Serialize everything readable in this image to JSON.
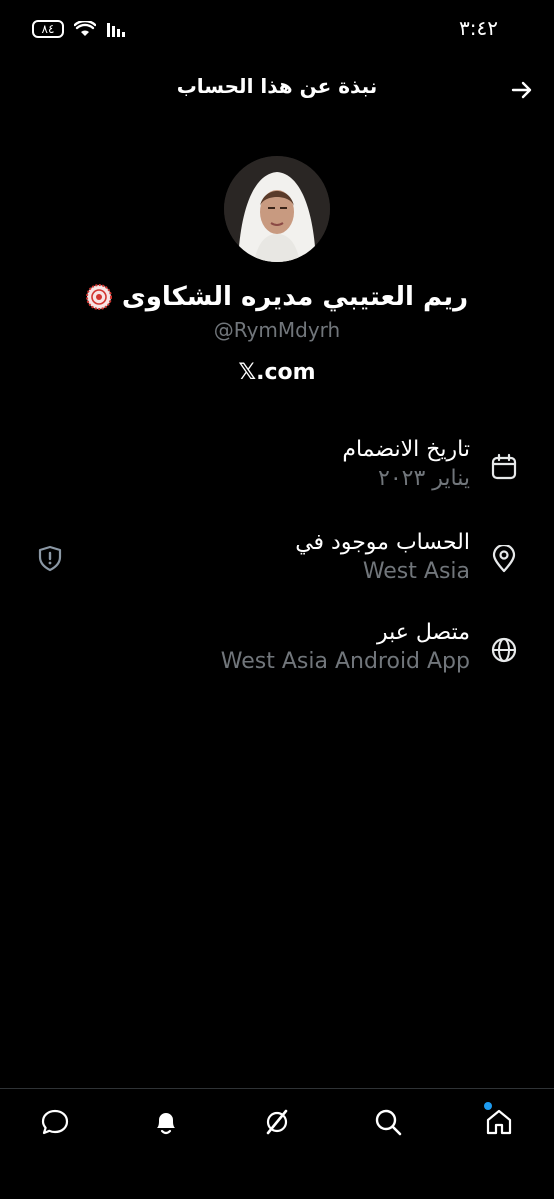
{
  "status_bar": {
    "time": "٣:٤٢",
    "battery": "٨٤"
  },
  "header": {
    "title": "نبذة عن هذا الحساب",
    "back_icon": "arrow-right-icon"
  },
  "profile": {
    "name": "ريم العتيبي مديره الشكاوى",
    "handle": "@RymMdyrh",
    "website": "𝕏.com"
  },
  "info": {
    "joined": {
      "title": "تاريخ الانضمام",
      "value": "يناير ٢٠٢٣",
      "icon": "calendar-icon"
    },
    "location": {
      "title": "الحساب موجود في",
      "value": "West Asia",
      "icon": "location-pin-icon"
    },
    "connected": {
      "title": "متصل عبر",
      "value": "West Asia Android App",
      "icon": "globe-icon"
    }
  },
  "colors": {
    "background": "#000000",
    "text": "#e7e9ea",
    "secondary": "#71767b",
    "accent": "#1d9bf0"
  },
  "nav": [
    "messages-icon",
    "notifications-icon",
    "grok-icon",
    "search-icon",
    "home-icon"
  ]
}
